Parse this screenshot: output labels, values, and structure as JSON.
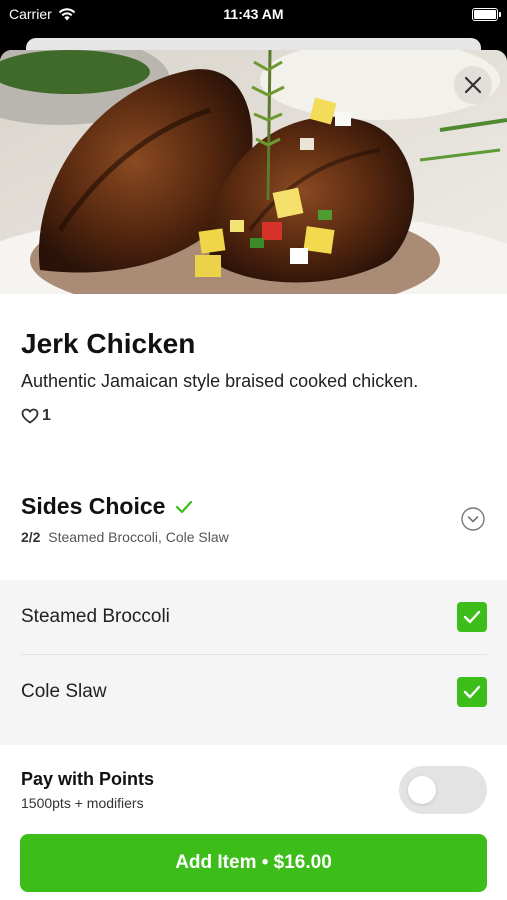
{
  "status_bar": {
    "carrier": "Carrier",
    "time": "11:43 AM"
  },
  "item": {
    "name": "Jerk Chicken",
    "description": "Authentic Jamaican style braised cooked chicken.",
    "likes": "1"
  },
  "sides": {
    "title": "Sides Choice",
    "count": "2/2",
    "selected_summary": "Steamed Broccoli, Cole Slaw",
    "options": [
      {
        "label": "Steamed Broccoli",
        "checked": true
      },
      {
        "label": "Cole Slaw",
        "checked": true
      }
    ]
  },
  "points": {
    "title": "Pay with Points",
    "subtitle": "1500pts + modifiers",
    "enabled": false
  },
  "add_button": {
    "label": "Add Item • $16.00"
  },
  "colors": {
    "accent": "#3cbd1a",
    "toggle_off": "#e3e3e3"
  },
  "icons": {
    "close": "close-icon",
    "heart": "heart-icon",
    "check": "check-icon",
    "chevron": "chevron-down-icon",
    "wifi": "wifi-icon",
    "battery": "battery-icon"
  }
}
